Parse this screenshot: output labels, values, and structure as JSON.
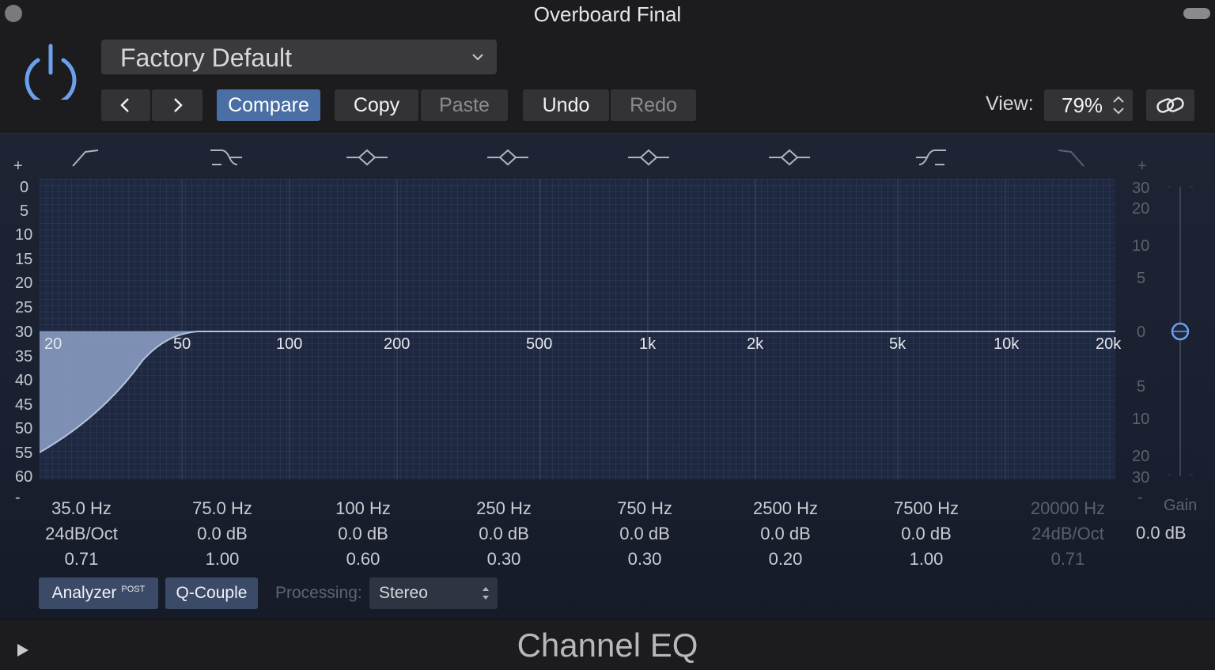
{
  "window": {
    "title": "Overboard Final"
  },
  "header": {
    "preset": "Factory Default",
    "compare_label": "Compare",
    "copy_label": "Copy",
    "paste_label": "Paste",
    "undo_label": "Undo",
    "redo_label": "Redo",
    "view_label": "View:",
    "view_value": "79%"
  },
  "eq": {
    "left_scale": [
      "+",
      "0",
      "5",
      "10",
      "15",
      "20",
      "25",
      "30",
      "35",
      "40",
      "45",
      "50",
      "55",
      "60",
      "-"
    ],
    "right_scale": [
      "+",
      "30",
      "20",
      "10",
      "5",
      "0",
      "5",
      "10",
      "20",
      "30",
      "-"
    ],
    "freq_labels": [
      "20",
      "50",
      "100",
      "200",
      "500",
      "1k",
      "2k",
      "5k",
      "10k",
      "20k"
    ],
    "bands": [
      {
        "freq": "35.0 Hz",
        "gain": "24dB/Oct",
        "q": "0.71",
        "enabled": true
      },
      {
        "freq": "75.0 Hz",
        "gain": "0.0 dB",
        "q": "1.00",
        "enabled": true
      },
      {
        "freq": "100 Hz",
        "gain": "0.0 dB",
        "q": "0.60",
        "enabled": true
      },
      {
        "freq": "250 Hz",
        "gain": "0.0 dB",
        "q": "0.30",
        "enabled": true
      },
      {
        "freq": "750 Hz",
        "gain": "0.0 dB",
        "q": "0.30",
        "enabled": true
      },
      {
        "freq": "2500 Hz",
        "gain": "0.0 dB",
        "q": "0.20",
        "enabled": true
      },
      {
        "freq": "7500 Hz",
        "gain": "0.0 dB",
        "q": "1.00",
        "enabled": true
      },
      {
        "freq": "20000 Hz",
        "gain": "24dB/Oct",
        "q": "0.71",
        "enabled": false
      }
    ],
    "band_icons": [
      "low-cut-icon",
      "low-shelf-icon",
      "bell-icon",
      "bell-icon",
      "bell-icon",
      "bell-icon",
      "high-shelf-icon",
      "high-cut-icon"
    ],
    "gain_label": "Gain",
    "gain_value": "0.0 dB"
  },
  "controls": {
    "analyzer_label": "Analyzer",
    "analyzer_tag": "POST",
    "qcouple_label": "Q-Couple",
    "processing_label": "Processing:",
    "processing_value": "Stereo"
  },
  "footer": {
    "plugin_name": "Channel EQ"
  },
  "colors": {
    "accent_blue": "#4a6fa5",
    "power_blue": "#6aa0ee",
    "curve_fill": "#8ea2c8",
    "graph_bg": "#1e2840"
  }
}
